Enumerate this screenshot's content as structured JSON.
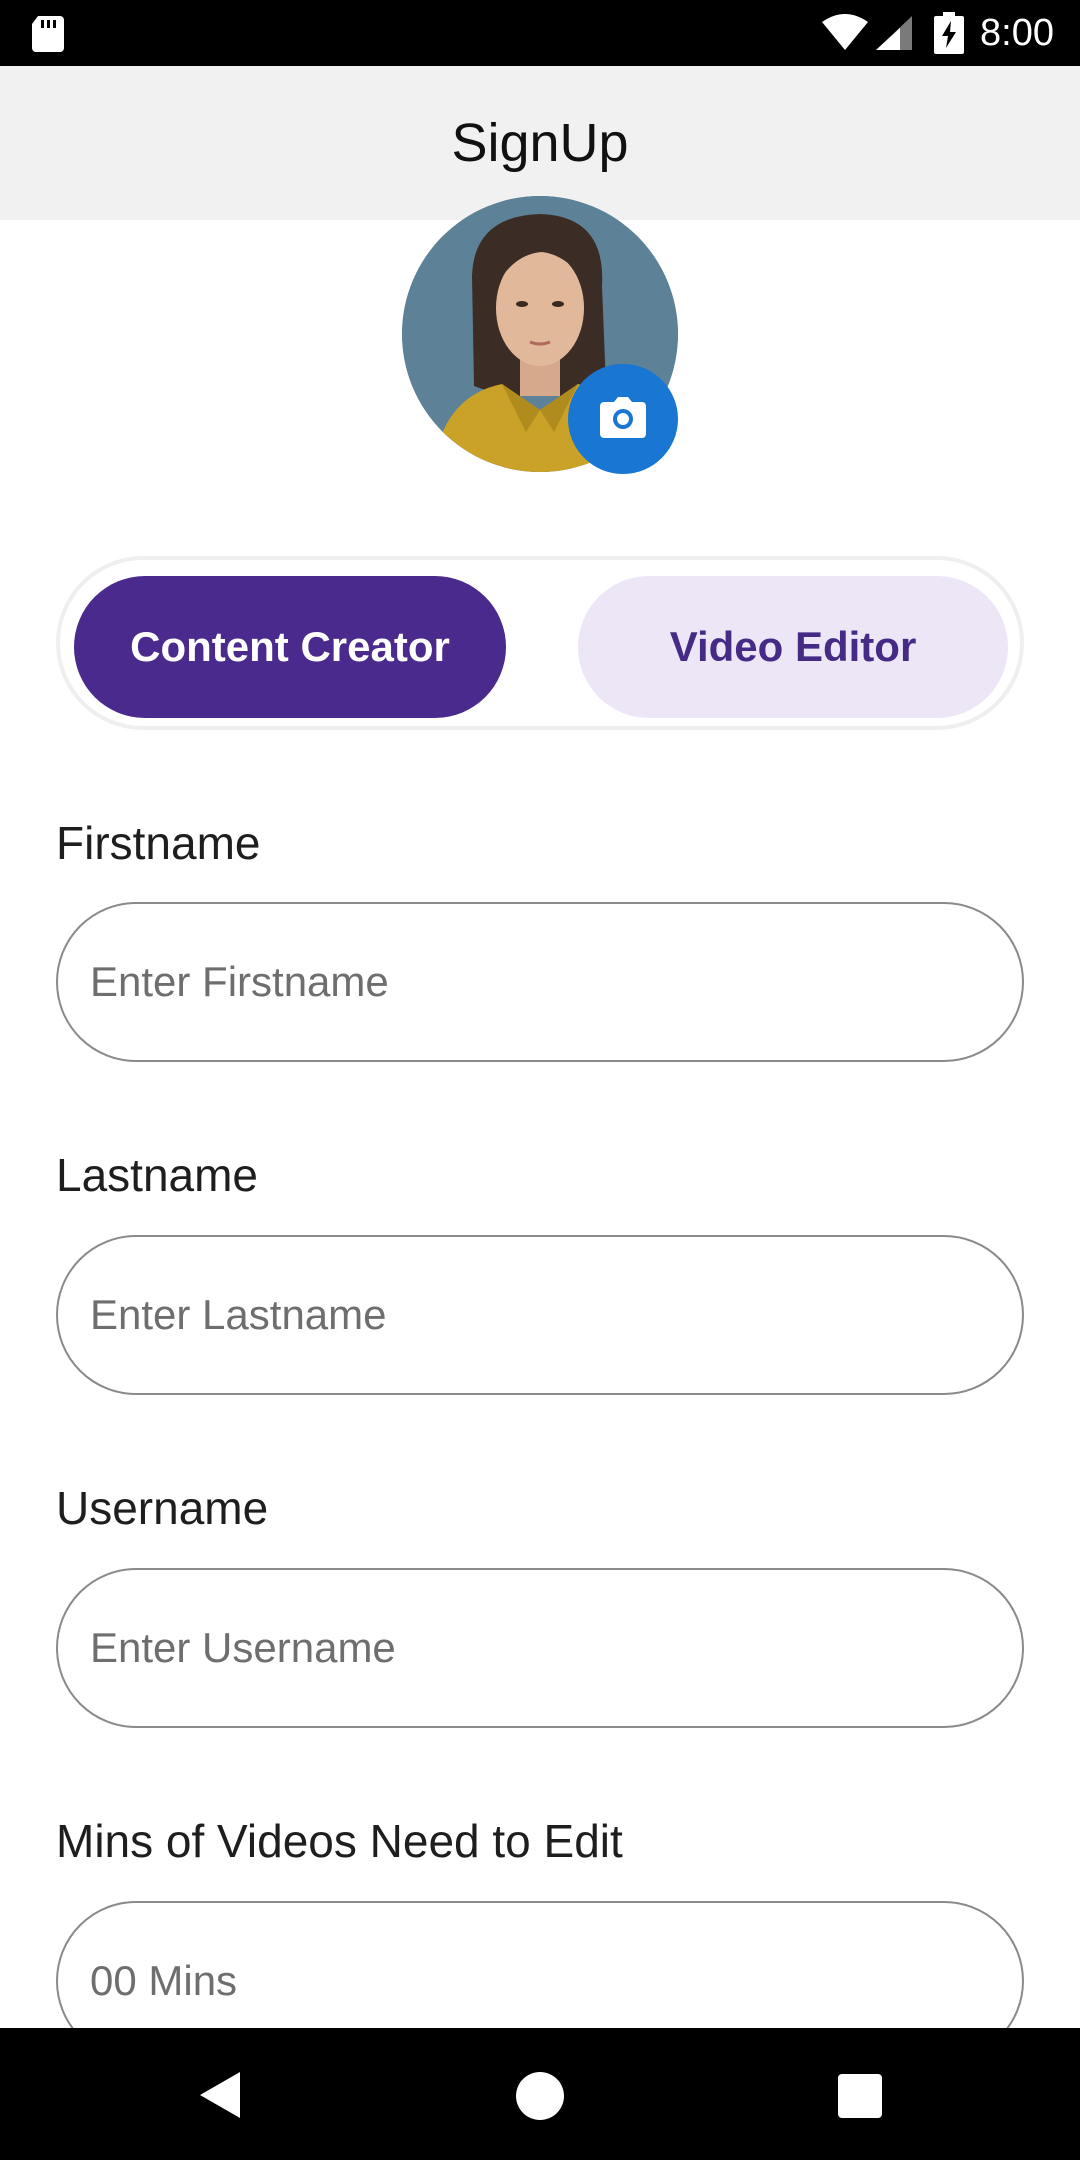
{
  "status_bar": {
    "time": "8:00",
    "icons": [
      "sd-card-icon",
      "wifi-icon",
      "signal-icon",
      "battery-charging-icon"
    ]
  },
  "app_bar": {
    "title": "SignUp"
  },
  "profile": {
    "avatar_icon": "avatar-photo",
    "camera_icon": "camera-icon",
    "camera_color": "#1976d2"
  },
  "role_toggle": {
    "options": [
      {
        "label": "Content Creator",
        "selected": true
      },
      {
        "label": "Video Editor",
        "selected": false
      }
    ],
    "selected_color": "#4a2a8c",
    "unselected_color": "#ece6f7"
  },
  "form": {
    "firstname": {
      "label": "Firstname",
      "placeholder": "Enter Firstname",
      "value": ""
    },
    "lastname": {
      "label": "Lastname",
      "placeholder": "Enter Lastname",
      "value": ""
    },
    "username": {
      "label": "Username",
      "placeholder": "Enter Username",
      "value": ""
    },
    "minutes": {
      "label": "Mins of Videos Need to Edit",
      "placeholder": "00 Mins",
      "value": ""
    }
  },
  "nav_bar": {
    "icons": [
      "back-icon",
      "home-icon",
      "recents-icon"
    ]
  }
}
